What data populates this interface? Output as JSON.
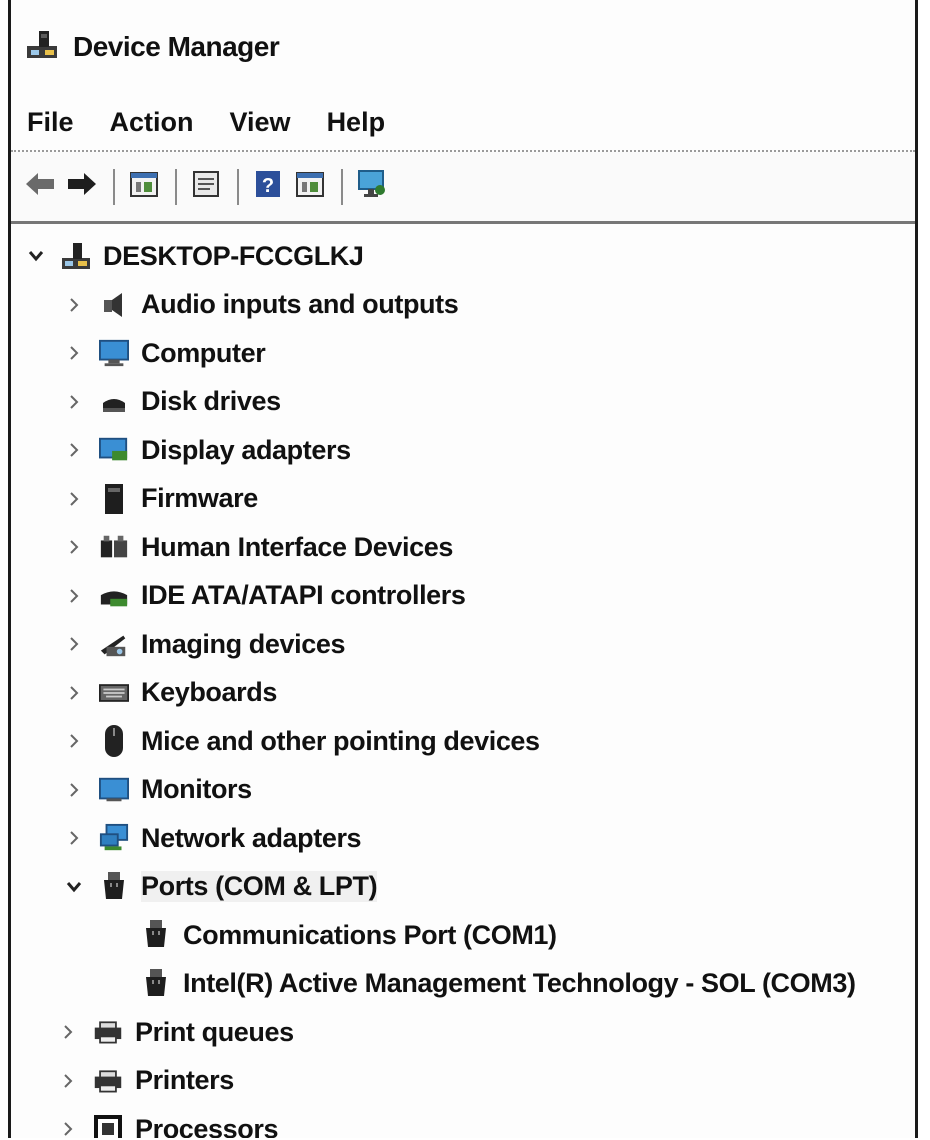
{
  "window": {
    "title": "Device Manager",
    "title_icon": "device-manager-icon"
  },
  "menu": [
    "File",
    "Action",
    "View",
    "Help"
  ],
  "toolbar": {
    "buttons": [
      "back-arrow-icon",
      "forward-arrow-icon",
      "properties-icon",
      "details-icon",
      "help-icon",
      "update-driver-icon",
      "scan-hardware-icon"
    ]
  },
  "tree": {
    "root": {
      "label": "DESKTOP-FCCGLKJ",
      "expanded": true,
      "icon": "computer-root-icon"
    },
    "items": [
      {
        "label": "Audio inputs and outputs",
        "icon": "speaker-icon",
        "expanded": false
      },
      {
        "label": "Computer",
        "icon": "monitor-icon",
        "expanded": false
      },
      {
        "label": "Disk drives",
        "icon": "disk-drive-icon",
        "expanded": false
      },
      {
        "label": "Display adapters",
        "icon": "display-adapter-icon",
        "expanded": false
      },
      {
        "label": "Firmware",
        "icon": "firmware-icon",
        "expanded": false
      },
      {
        "label": "Human Interface Devices",
        "icon": "hid-icon",
        "expanded": false
      },
      {
        "label": "IDE ATA/ATAPI controllers",
        "icon": "ide-controller-icon",
        "expanded": false
      },
      {
        "label": "Imaging devices",
        "icon": "camera-icon",
        "expanded": false
      },
      {
        "label": "Keyboards",
        "icon": "keyboard-icon",
        "expanded": false
      },
      {
        "label": "Mice and other pointing devices",
        "icon": "mouse-icon",
        "expanded": false
      },
      {
        "label": "Monitors",
        "icon": "monitor-icon",
        "expanded": false
      },
      {
        "label": "Network adapters",
        "icon": "network-adapter-icon",
        "expanded": false
      },
      {
        "label": "Ports (COM & LPT)",
        "icon": "port-icon",
        "expanded": true,
        "selected": true,
        "children": [
          {
            "label": "Communications Port (COM1)",
            "icon": "port-icon"
          },
          {
            "label": "Intel(R) Active Management Technology - SOL (COM3)",
            "icon": "port-icon"
          }
        ]
      },
      {
        "label": "Print queues",
        "icon": "printer-icon",
        "expanded": false
      },
      {
        "label": "Printers",
        "icon": "printer-icon",
        "expanded": false
      },
      {
        "label": "Processors",
        "icon": "processor-icon",
        "expanded": false
      }
    ]
  }
}
